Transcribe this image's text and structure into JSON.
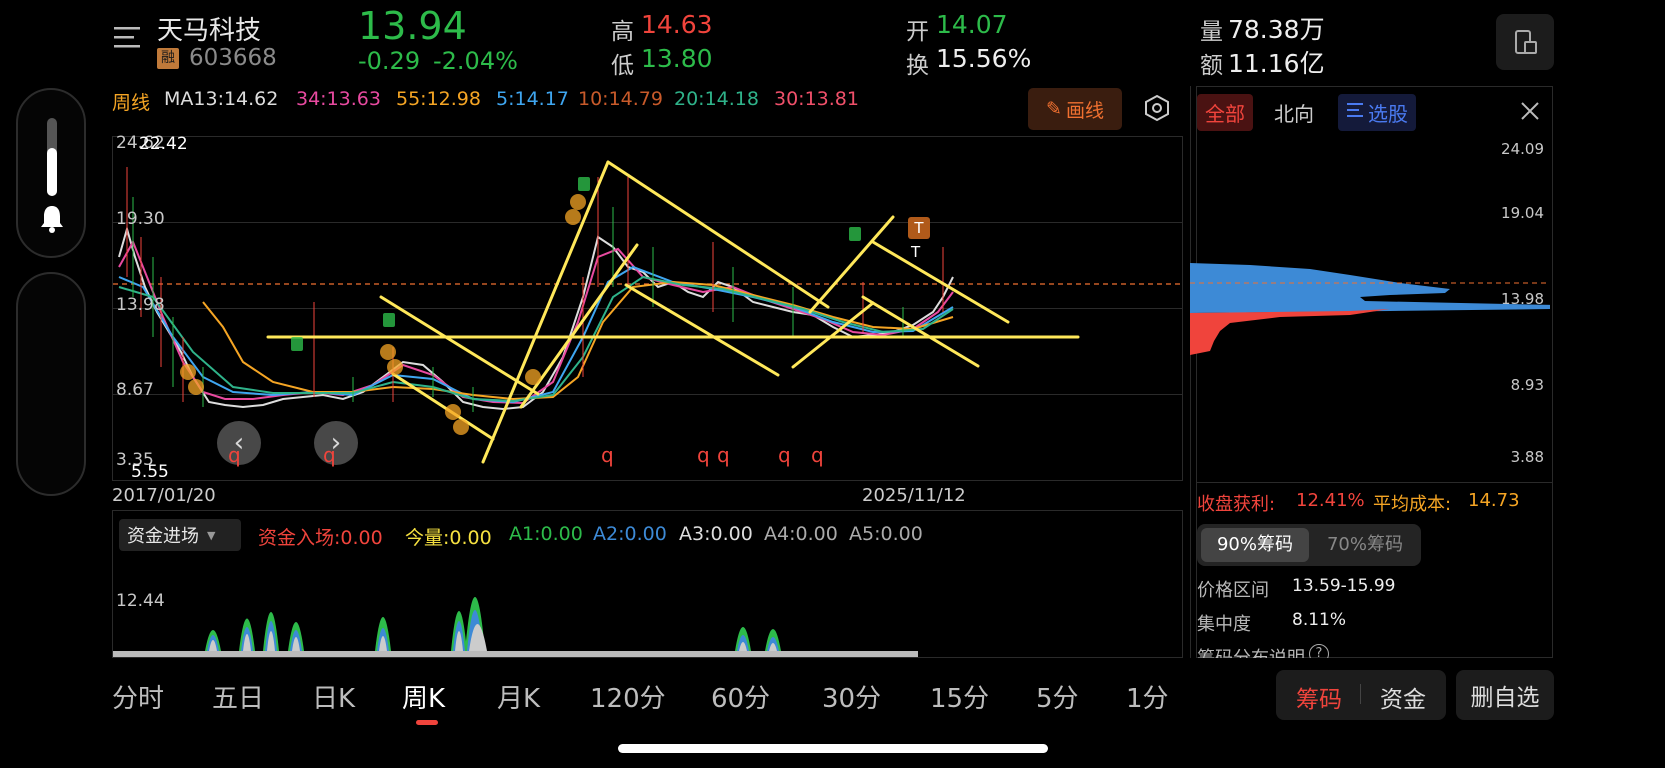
{
  "header": {
    "stock_name": "天马科技",
    "rong_badge": "融",
    "stock_code": "603668",
    "price": "13.94",
    "change": "-0.29",
    "change_pct": "-2.04%",
    "high_label": "高",
    "high_value": "14.63",
    "low_label": "低",
    "low_value": "13.80",
    "open_label": "开",
    "open_value": "14.07",
    "turnover_label": "换",
    "turnover_value": "15.56%",
    "volume_label": "量",
    "volume_value": "78.38万",
    "amount_label": "额",
    "amount_value": "11.16亿"
  },
  "ma_bar": {
    "period": "周线",
    "ma13": "MA13:14.62",
    "ma34": "34:13.63",
    "ma55": "55:12.98",
    "ma5": "5:14.17",
    "ma10": "10:14.79",
    "ma20": "20:14.18",
    "ma30": "30:13.81",
    "draw_button": "画线"
  },
  "chart": {
    "y_top_a": "24.62",
    "y_top_b": "22.42",
    "y_19": "19.30",
    "y_13": "13.98",
    "y_8": "8.67",
    "y_3": "3.35",
    "y_low": "5.55",
    "date_start": "2017/01/20",
    "date_end": "2025/11/12",
    "tag_t1": "T",
    "tag_t2": "T",
    "signal": "q"
  },
  "chip_panel": {
    "tab_all": "全部",
    "tab_north": "北向",
    "tab_select": "选股",
    "price_1": "24.09",
    "price_2": "19.04",
    "price_3": "13.98",
    "price_4": "8.93",
    "price_5": "3.88",
    "profit_label": "收盘获利:",
    "profit_value": "12.41%",
    "avg_cost_label": "平均成本:",
    "avg_cost_value": "14.73",
    "chip90": "90%筹码",
    "chip70": "70%筹码",
    "range_label": "价格区间",
    "range_value": "13.59-15.99",
    "concentration_label": "集中度",
    "concentration_value": "8.11%",
    "explain_label": "筹码分布说明",
    "help": "?"
  },
  "indicator": {
    "select_label": "资金进场",
    "inflow": "资金入场:0.00",
    "volume": "今量:0.00",
    "a1": "A1:0.00",
    "a2": "A2:0.00",
    "a3": "A3:0.00",
    "a4": "A4:0.00",
    "a5": "A5:0.00",
    "y_label": "12.44"
  },
  "bottom_tabs": [
    "分时",
    "五日",
    "日K",
    "周K",
    "月K",
    "120分",
    "60分",
    "30分",
    "15分",
    "5分",
    "1分"
  ],
  "bottom_buttons": {
    "chips": "筹码",
    "funds": "资金",
    "remove_watch": "删自选"
  },
  "colors": {
    "up": "#f0443c",
    "down": "#2dbb4a",
    "accent": "#f07030",
    "chip_blue": "#3d8ad6",
    "chip_red": "#f0443c",
    "trend_line": "#ffe85a"
  }
}
